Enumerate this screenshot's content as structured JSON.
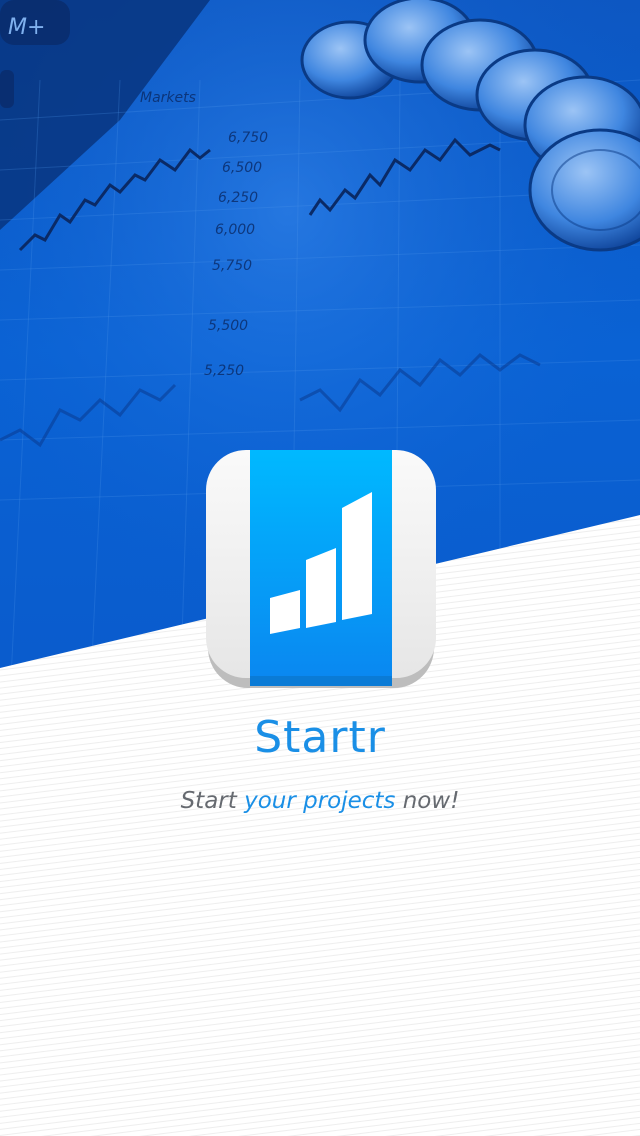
{
  "splash": {
    "app_name": "Startr",
    "tagline": {
      "part1": "Start ",
      "part2": "your projects",
      "part3": " now!"
    }
  },
  "background": {
    "price_labels": [
      "6,750",
      "6,500",
      "6,250",
      "6,000",
      "5,750",
      "5,500",
      "5,250"
    ],
    "panel_label": "Markets",
    "calc_key": "M+"
  },
  "colors": {
    "brand_blue": "#1a8fe6",
    "photo_tint": "#0a5fd0",
    "tagline_gray": "#666a70"
  },
  "icons": {
    "app_icon": "bar-chart-book-icon"
  }
}
